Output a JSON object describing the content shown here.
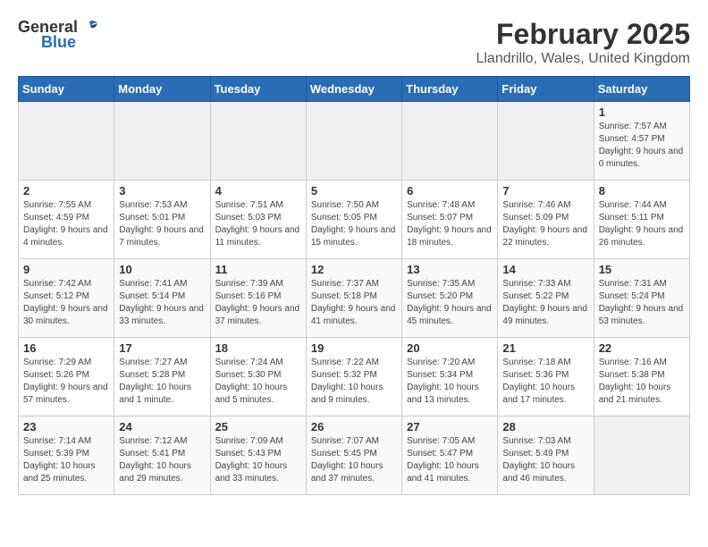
{
  "header": {
    "logo_general": "General",
    "logo_blue": "Blue",
    "title": "February 2025",
    "subtitle": "Llandrillo, Wales, United Kingdom"
  },
  "weekdays": [
    "Sunday",
    "Monday",
    "Tuesday",
    "Wednesday",
    "Thursday",
    "Friday",
    "Saturday"
  ],
  "weeks": [
    [
      {
        "day": "",
        "info": ""
      },
      {
        "day": "",
        "info": ""
      },
      {
        "day": "",
        "info": ""
      },
      {
        "day": "",
        "info": ""
      },
      {
        "day": "",
        "info": ""
      },
      {
        "day": "",
        "info": ""
      },
      {
        "day": "1",
        "info": "Sunrise: 7:57 AM\nSunset: 4:57 PM\nDaylight: 9 hours and 0 minutes."
      }
    ],
    [
      {
        "day": "2",
        "info": "Sunrise: 7:55 AM\nSunset: 4:59 PM\nDaylight: 9 hours and 4 minutes."
      },
      {
        "day": "3",
        "info": "Sunrise: 7:53 AM\nSunset: 5:01 PM\nDaylight: 9 hours and 7 minutes."
      },
      {
        "day": "4",
        "info": "Sunrise: 7:51 AM\nSunset: 5:03 PM\nDaylight: 9 hours and 11 minutes."
      },
      {
        "day": "5",
        "info": "Sunrise: 7:50 AM\nSunset: 5:05 PM\nDaylight: 9 hours and 15 minutes."
      },
      {
        "day": "6",
        "info": "Sunrise: 7:48 AM\nSunset: 5:07 PM\nDaylight: 9 hours and 18 minutes."
      },
      {
        "day": "7",
        "info": "Sunrise: 7:46 AM\nSunset: 5:09 PM\nDaylight: 9 hours and 22 minutes."
      },
      {
        "day": "8",
        "info": "Sunrise: 7:44 AM\nSunset: 5:11 PM\nDaylight: 9 hours and 26 minutes."
      }
    ],
    [
      {
        "day": "9",
        "info": "Sunrise: 7:42 AM\nSunset: 5:12 PM\nDaylight: 9 hours and 30 minutes."
      },
      {
        "day": "10",
        "info": "Sunrise: 7:41 AM\nSunset: 5:14 PM\nDaylight: 9 hours and 33 minutes."
      },
      {
        "day": "11",
        "info": "Sunrise: 7:39 AM\nSunset: 5:16 PM\nDaylight: 9 hours and 37 minutes."
      },
      {
        "day": "12",
        "info": "Sunrise: 7:37 AM\nSunset: 5:18 PM\nDaylight: 9 hours and 41 minutes."
      },
      {
        "day": "13",
        "info": "Sunrise: 7:35 AM\nSunset: 5:20 PM\nDaylight: 9 hours and 45 minutes."
      },
      {
        "day": "14",
        "info": "Sunrise: 7:33 AM\nSunset: 5:22 PM\nDaylight: 9 hours and 49 minutes."
      },
      {
        "day": "15",
        "info": "Sunrise: 7:31 AM\nSunset: 5:24 PM\nDaylight: 9 hours and 53 minutes."
      }
    ],
    [
      {
        "day": "16",
        "info": "Sunrise: 7:29 AM\nSunset: 5:26 PM\nDaylight: 9 hours and 57 minutes."
      },
      {
        "day": "17",
        "info": "Sunrise: 7:27 AM\nSunset: 5:28 PM\nDaylight: 10 hours and 1 minute."
      },
      {
        "day": "18",
        "info": "Sunrise: 7:24 AM\nSunset: 5:30 PM\nDaylight: 10 hours and 5 minutes."
      },
      {
        "day": "19",
        "info": "Sunrise: 7:22 AM\nSunset: 5:32 PM\nDaylight: 10 hours and 9 minutes."
      },
      {
        "day": "20",
        "info": "Sunrise: 7:20 AM\nSunset: 5:34 PM\nDaylight: 10 hours and 13 minutes."
      },
      {
        "day": "21",
        "info": "Sunrise: 7:18 AM\nSunset: 5:36 PM\nDaylight: 10 hours and 17 minutes."
      },
      {
        "day": "22",
        "info": "Sunrise: 7:16 AM\nSunset: 5:38 PM\nDaylight: 10 hours and 21 minutes."
      }
    ],
    [
      {
        "day": "23",
        "info": "Sunrise: 7:14 AM\nSunset: 5:39 PM\nDaylight: 10 hours and 25 minutes."
      },
      {
        "day": "24",
        "info": "Sunrise: 7:12 AM\nSunset: 5:41 PM\nDaylight: 10 hours and 29 minutes."
      },
      {
        "day": "25",
        "info": "Sunrise: 7:09 AM\nSunset: 5:43 PM\nDaylight: 10 hours and 33 minutes."
      },
      {
        "day": "26",
        "info": "Sunrise: 7:07 AM\nSunset: 5:45 PM\nDaylight: 10 hours and 37 minutes."
      },
      {
        "day": "27",
        "info": "Sunrise: 7:05 AM\nSunset: 5:47 PM\nDaylight: 10 hours and 41 minutes."
      },
      {
        "day": "28",
        "info": "Sunrise: 7:03 AM\nSunset: 5:49 PM\nDaylight: 10 hours and 46 minutes."
      },
      {
        "day": "",
        "info": ""
      }
    ]
  ]
}
